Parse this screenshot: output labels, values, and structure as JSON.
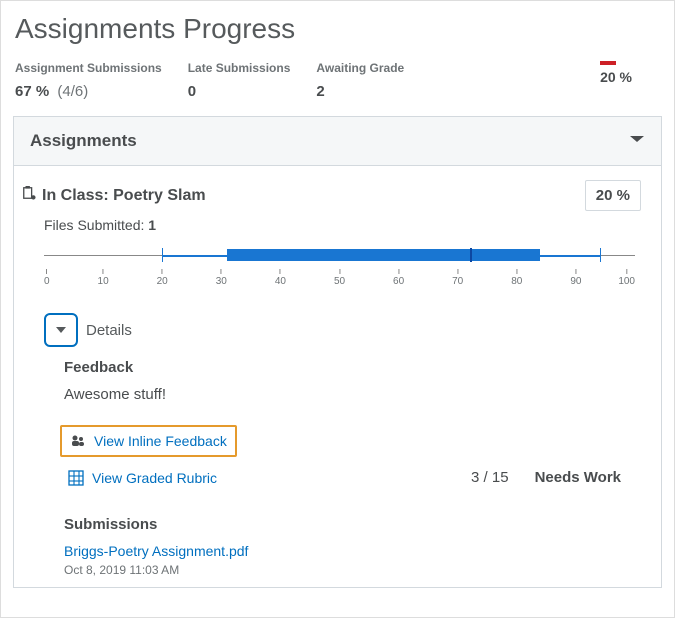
{
  "page_title": "Assignments Progress",
  "stats": {
    "submissions_label": "Assignment Submissions",
    "submissions_value": "67 %",
    "submissions_frac": "(4/6)",
    "late_label": "Late Submissions",
    "late_value": "0",
    "awaiting_label": "Awaiting Grade",
    "awaiting_value": "2",
    "sparkline_value": "20 %"
  },
  "panel": {
    "header": "Assignments"
  },
  "assignment": {
    "title": "In Class: Poetry Slam",
    "score_badge": "20 %",
    "files_label": "Files Submitted:",
    "files_count": "1"
  },
  "chart_data": {
    "type": "boxplot",
    "x_range": [
      0,
      100
    ],
    "ticks": [
      0,
      10,
      20,
      30,
      40,
      50,
      60,
      70,
      80,
      90,
      100
    ],
    "whisker_min": 20,
    "q1": 31,
    "median": 72,
    "q3": 84,
    "whisker_max": 94
  },
  "details": {
    "toggle_label": "Details",
    "feedback_head": "Feedback",
    "feedback_text": "Awesome stuff!",
    "inline_feedback_label": "View Inline Feedback",
    "rubric_label": "View Graded Rubric",
    "rubric_score": "3 / 15",
    "rubric_level": "Needs Work",
    "submissions_head": "Submissions",
    "submission_file": "Briggs-Poetry Assignment.pdf",
    "submission_time": "Oct 8, 2019 11:03 AM"
  }
}
